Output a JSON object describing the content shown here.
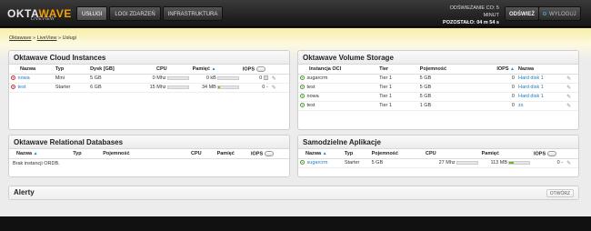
{
  "header": {
    "logo_part1": "OKTA",
    "logo_part2": "WAVE",
    "logo_sub": "LIVEVIEW",
    "nav": [
      {
        "label": "USŁUGI",
        "active": true
      },
      {
        "label": "LOGI ZDARZEŃ",
        "active": false
      },
      {
        "label": "INFRASTRUKTURA",
        "active": false
      }
    ],
    "refresh_label": "ODŚWIEŻANIE CO: 5 MINUT",
    "remaining_label": "POZOSTAŁO: 04 m 54 s",
    "refresh_button": "ODŚWIEŻ",
    "logout_button": "WYLOGUJ"
  },
  "breadcrumb": {
    "items": [
      "Oktawave",
      "LiveView"
    ],
    "current": "Usługi"
  },
  "cloud_instances": {
    "title": "Oktawave Cloud Instances",
    "columns": [
      "Nazwa",
      "Typ",
      "Dysk [GB]",
      "CPU",
      "Pamięć",
      "IOPS"
    ],
    "rows": [
      {
        "name": "nowa",
        "status": "red",
        "type": "Mini",
        "disk": "5 GB",
        "cpu": "0 Mhz",
        "mem": "0 kB",
        "iops": "0",
        "cpu_pct": 0,
        "mem_pct": 0
      },
      {
        "name": "test",
        "status": "red",
        "type": "Starter",
        "disk": "6 GB",
        "cpu": "15 Mhz",
        "mem": "34 MB",
        "iops": "0",
        "cpu_pct": 0,
        "mem_pct": 8
      }
    ],
    "dash": "-"
  },
  "volume_storage": {
    "title": "Oktawave Volume Storage",
    "columns": [
      "Instancja OCI",
      "Tier",
      "Pojemność",
      "IOPS",
      "Nazwa"
    ],
    "rows": [
      {
        "instance": "sugarcrm",
        "tier": "Tier 1",
        "size": "5 GB",
        "iops": "0",
        "name": "Hard disk 1"
      },
      {
        "instance": "test",
        "tier": "Tier 1",
        "size": "5 GB",
        "iops": "0",
        "name": "Hard disk 1"
      },
      {
        "instance": "nowa",
        "tier": "Tier 1",
        "size": "5 GB",
        "iops": "0",
        "name": "Hard disk 1"
      },
      {
        "instance": "test",
        "tier": "Tier 1",
        "size": "1 GB",
        "iops": "0",
        "name": "zs"
      }
    ]
  },
  "databases": {
    "title": "Oktawave Relational Databases",
    "columns": [
      "Nazwa",
      "Typ",
      "Pojemność",
      "CPU",
      "Pamięć",
      "IOPS"
    ],
    "empty": "Brak instancji ORDB."
  },
  "apps": {
    "title": "Samodzielne Aplikacje",
    "columns": [
      "Nazwa",
      "Typ",
      "Pojemność",
      "CPU",
      "Pamięć",
      "IOPS"
    ],
    "rows": [
      {
        "name": "sugarcrm",
        "type": "Starter",
        "size": "5 GB",
        "cpu": "27 Mhz",
        "mem": "113 MB",
        "iops": "0",
        "cpu_pct": 0,
        "mem_pct": 25
      }
    ],
    "dash": "-"
  },
  "alerts": {
    "title": "Alerty",
    "open_button": "OTWÓRZ"
  },
  "colors": {
    "accent": "#f2a100",
    "link": "#1a7fc4",
    "bar": "#6bb92b"
  }
}
